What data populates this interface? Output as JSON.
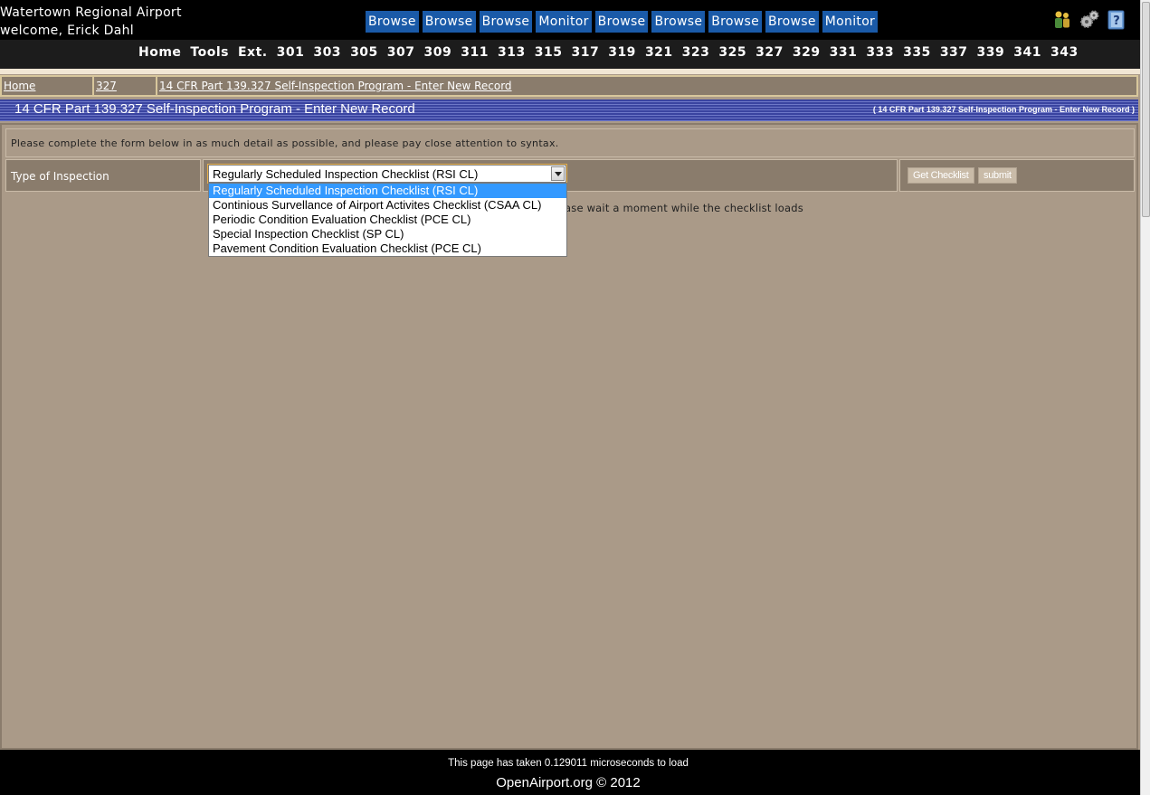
{
  "header": {
    "site_title": "Watertown Regional Airport",
    "welcome": "welcome, Erick Dahl",
    "top_buttons": [
      "Browse",
      "Browse",
      "Browse",
      "Monitor",
      "Browse",
      "Browse",
      "Browse",
      "Browse",
      "Monitor"
    ],
    "nav_links": [
      "Home",
      "Tools",
      "Ext.",
      "301",
      "303",
      "305",
      "307",
      "309",
      "311",
      "313",
      "315",
      "317",
      "319",
      "321",
      "323",
      "325",
      "327",
      "329",
      "331",
      "333",
      "335",
      "337",
      "339",
      "341",
      "343"
    ],
    "icons": [
      "users-icon",
      "gears-icon",
      "help-icon"
    ]
  },
  "breadcrumb": {
    "items": [
      "Home",
      "327",
      "14 CFR Part 139.327 Self-Inspection Program - Enter New Record"
    ]
  },
  "title_band": {
    "title": "14 CFR Part 139.327 Self-Inspection Program - Enter New Record",
    "right_text": "( 14 CFR Part 139.327 Self-Inspection Program - Enter New Record )"
  },
  "form": {
    "instructions": "Please complete the form below in as much detail as possible, and please pay close attention to syntax.",
    "type_label": "Type of Inspection",
    "selected_value": "Regularly Scheduled Inspection Checklist  (RSI CL)",
    "options": [
      "Regularly Scheduled Inspection Checklist  (RSI CL)",
      "Continious Survellance of Airport Activites Checklist  (CSAA CL)",
      "Periodic Condition Evaluation Checklist  (PCE CL)",
      "Special Inspection Checklist  (SP CL)",
      "Pavement Condition Evaluation Checklist  (PCE CL)"
    ],
    "get_checklist_label": "Get Checklist",
    "submit_label": "submit",
    "loading_text": "ase wait a moment while the checklist loads"
  },
  "footer": {
    "load_time": "This page has taken 0.129011 microseconds to load",
    "copyright": "OpenAirport.org © 2012"
  },
  "colors": {
    "background": "#aa9a88",
    "header": "#1c1c1c",
    "button_blue": "#1a5aa8",
    "title_band": "#3a44a0",
    "selected_option": "#3399ff"
  }
}
